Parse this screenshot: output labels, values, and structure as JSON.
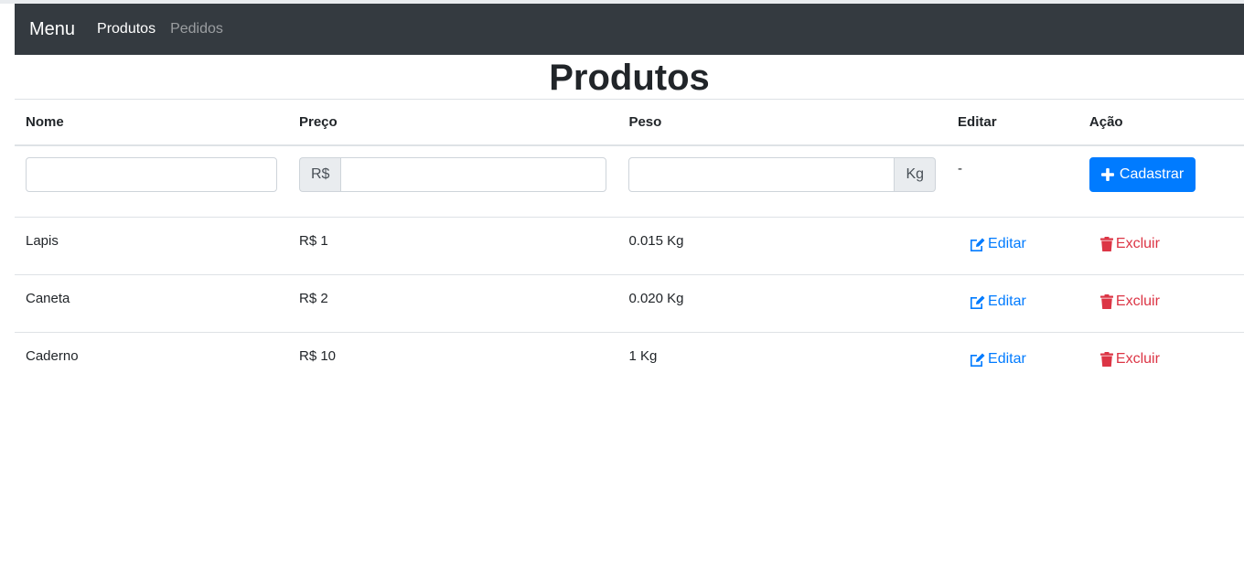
{
  "navbar": {
    "brand": "Menu",
    "links": [
      {
        "label": "Produtos",
        "active": true
      },
      {
        "label": "Pedidos",
        "active": false
      }
    ]
  },
  "page": {
    "title": "Produtos"
  },
  "table": {
    "headers": [
      "Nome",
      "Preço",
      "Peso",
      "Editar",
      "Ação"
    ],
    "form": {
      "nome_value": "",
      "preco_prefix": "R$",
      "preco_value": "",
      "peso_value": "",
      "peso_suffix": "Kg",
      "editar_placeholder": "-",
      "submit_label": "Cadastrar"
    },
    "rows": [
      {
        "nome": "Lapis",
        "preco": "R$ 1",
        "peso": "0.015 Kg",
        "edit_label": "Editar",
        "delete_label": "Excluir"
      },
      {
        "nome": "Caneta",
        "preco": "R$ 2",
        "peso": "0.020 Kg",
        "edit_label": "Editar",
        "delete_label": "Excluir"
      },
      {
        "nome": "Caderno",
        "preco": "R$ 10",
        "peso": "1 Kg",
        "edit_label": "Editar",
        "delete_label": "Excluir"
      }
    ]
  },
  "icons": {
    "add": "plus-icon",
    "edit": "edit-icon",
    "delete": "trash-icon"
  },
  "colors": {
    "navbar_bg": "#343a40",
    "primary": "#007bff",
    "danger": "#dc3545"
  }
}
